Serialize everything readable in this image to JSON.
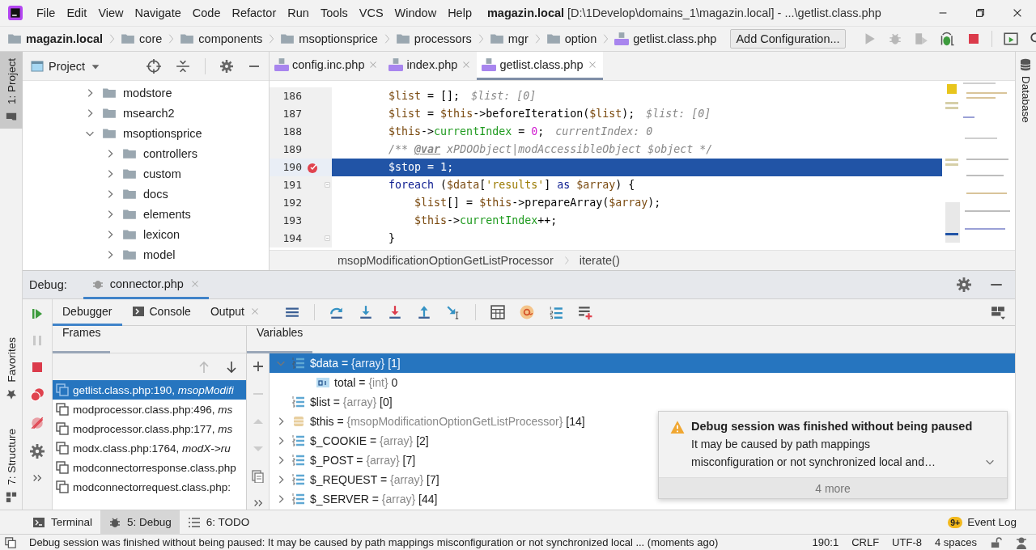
{
  "window": {
    "project": "magazin.local",
    "title": "[D:\\1Develop\\domains_1\\magazin.local] - ...\\getlist.class.php"
  },
  "menu": [
    "File",
    "Edit",
    "View",
    "Navigate",
    "Code",
    "Refactor",
    "Run",
    "Tools",
    "VCS",
    "Window",
    "Help"
  ],
  "navbar": {
    "crumbs": [
      {
        "label": "magazin.local",
        "kind": "root"
      },
      {
        "label": "core",
        "kind": "folder"
      },
      {
        "label": "components",
        "kind": "folder"
      },
      {
        "label": "msoptionsprice",
        "kind": "folder"
      },
      {
        "label": "processors",
        "kind": "folder"
      },
      {
        "label": "mgr",
        "kind": "folder"
      },
      {
        "label": "option",
        "kind": "folder"
      },
      {
        "label": "getlist.class.php",
        "kind": "php"
      }
    ],
    "config_button": "Add Configuration..."
  },
  "left_strip": [
    {
      "label": "1: Project",
      "kind": "project",
      "selected": true
    },
    {
      "label": "Favorites",
      "kind": "favorites",
      "selected": false
    },
    {
      "label": "7: Structure",
      "kind": "structure",
      "selected": false
    }
  ],
  "right_strip": [
    {
      "label": "Database"
    }
  ],
  "project_panel": {
    "title": "Project",
    "tree": [
      {
        "label": "modstore",
        "expanded": false
      },
      {
        "label": "msearch2",
        "expanded": false
      },
      {
        "label": "msoptionsprice",
        "expanded": true,
        "children": [
          {
            "label": "controllers",
            "expanded": false
          },
          {
            "label": "custom",
            "expanded": false
          },
          {
            "label": "docs",
            "expanded": false
          },
          {
            "label": "elements",
            "expanded": false
          },
          {
            "label": "lexicon",
            "expanded": false
          },
          {
            "label": "model",
            "expanded": false
          }
        ]
      }
    ]
  },
  "editor": {
    "tabs": [
      {
        "label": "config.inc.php",
        "selected": false
      },
      {
        "label": "index.php",
        "selected": false
      },
      {
        "label": "getlist.class.php",
        "selected": true
      }
    ],
    "lines": [
      {
        "number": "186",
        "selected": false,
        "breakpoint": false,
        "fold": false,
        "tokens": [
          {
            "text": "        $list",
            "kind": "var"
          },
          {
            "text": " = [];",
            "kind": "plain"
          },
          {
            "text": "$list: [0]",
            "kind": "hint"
          }
        ]
      },
      {
        "number": "187",
        "selected": false,
        "breakpoint": false,
        "fold": false,
        "tokens": [
          {
            "text": "        $list",
            "kind": "var"
          },
          {
            "text": " = ",
            "kind": "plain"
          },
          {
            "text": "$this",
            "kind": "var"
          },
          {
            "text": "->beforeIteration(",
            "kind": "plain"
          },
          {
            "text": "$list",
            "kind": "var"
          },
          {
            "text": ");",
            "kind": "plain"
          },
          {
            "text": "$list: [0]",
            "kind": "hint"
          }
        ]
      },
      {
        "number": "188",
        "selected": false,
        "breakpoint": false,
        "fold": false,
        "tokens": [
          {
            "text": "        $this",
            "kind": "var"
          },
          {
            "text": "->",
            "kind": "plain"
          },
          {
            "text": "currentIndex",
            "kind": "field"
          },
          {
            "text": " = ",
            "kind": "plain"
          },
          {
            "text": "0",
            "kind": "number"
          },
          {
            "text": ";",
            "kind": "plain"
          },
          {
            "text": "currentIndex: 0",
            "kind": "hint"
          }
        ]
      },
      {
        "number": "189",
        "selected": false,
        "breakpoint": false,
        "fold": false,
        "tokens": [
          {
            "text": "        /** ",
            "kind": "comment"
          },
          {
            "text": "@var",
            "kind": "doctag"
          },
          {
            "text": " xPDOObject|modAccessibleObject $object */",
            "kind": "comment"
          }
        ]
      },
      {
        "number": "190",
        "selected": true,
        "breakpoint": true,
        "fold": false,
        "tokens": [
          {
            "text": "        $stop",
            "kind": "var"
          },
          {
            "text": " = ",
            "kind": "plain"
          },
          {
            "text": "1",
            "kind": "number"
          },
          {
            "text": ";",
            "kind": "plain"
          }
        ]
      },
      {
        "number": "191",
        "selected": false,
        "breakpoint": false,
        "fold": true,
        "tokens": [
          {
            "text": "        foreach",
            "kind": "keyword"
          },
          {
            "text": " (",
            "kind": "plain"
          },
          {
            "text": "$data",
            "kind": "var"
          },
          {
            "text": "[",
            "kind": "plain"
          },
          {
            "text": "'results'",
            "kind": "string"
          },
          {
            "text": "] ",
            "kind": "plain"
          },
          {
            "text": "as",
            "kind": "keyword"
          },
          {
            "text": " $array",
            "kind": "var"
          },
          {
            "text": ") {",
            "kind": "plain"
          }
        ]
      },
      {
        "number": "192",
        "selected": false,
        "breakpoint": false,
        "fold": false,
        "tokens": [
          {
            "text": "            $list",
            "kind": "var"
          },
          {
            "text": "[] = ",
            "kind": "plain"
          },
          {
            "text": "$this",
            "kind": "var"
          },
          {
            "text": "->prepareArray(",
            "kind": "plain"
          },
          {
            "text": "$array",
            "kind": "var"
          },
          {
            "text": ");",
            "kind": "plain"
          }
        ]
      },
      {
        "number": "193",
        "selected": false,
        "breakpoint": false,
        "fold": false,
        "tokens": [
          {
            "text": "            $this",
            "kind": "var"
          },
          {
            "text": "->",
            "kind": "plain"
          },
          {
            "text": "currentIndex",
            "kind": "field"
          },
          {
            "text": "++;",
            "kind": "plain"
          }
        ]
      },
      {
        "number": "194",
        "selected": false,
        "breakpoint": false,
        "fold": true,
        "tokens": [
          {
            "text": "        }",
            "kind": "plain"
          }
        ]
      }
    ],
    "breadcrumb": [
      "msopModificationOptionGetListProcessor",
      "iterate()"
    ]
  },
  "debug": {
    "label": "Debug:",
    "session_tab": {
      "label": "connector.php",
      "selected": true
    },
    "tabs": [
      {
        "label": "Debugger",
        "kind": "plain",
        "selected": true
      },
      {
        "label": "Console",
        "kind": "console",
        "selected": false
      },
      {
        "label": "Output",
        "kind": "closable",
        "selected": false
      }
    ],
    "frames_title": "Frames",
    "variables_title": "Variables",
    "frames": [
      {
        "text": "getlist.class.php:190, *msopModifi*",
        "selected": true
      },
      {
        "text": "modprocessor.class.php:496, *ms*",
        "selected": false
      },
      {
        "text": "modprocessor.class.php:177, *ms*",
        "selected": false
      },
      {
        "text": "modx.class.php:1764, *modX->ru*",
        "selected": false
      },
      {
        "text": "modconnectorresponse.class.php",
        "selected": false
      },
      {
        "text": "modconnectorrequest.class.php:",
        "selected": false
      }
    ],
    "variables": [
      {
        "name": "$data =",
        "type": "{array}",
        "value": "[1]",
        "kind": "array",
        "expanded": true,
        "selected": true,
        "children": [
          {
            "name": "total =",
            "type": "{int}",
            "value": "0",
            "kind": "int",
            "selected": false
          }
        ]
      },
      {
        "name": "$list =",
        "type": "{array}",
        "value": "[0]",
        "kind": "array",
        "selected": false
      },
      {
        "name": "$this =",
        "type": "{msopModificationOptionGetListProcessor}",
        "value": "[14]",
        "kind": "object",
        "expanded": false,
        "selected": false
      },
      {
        "name": "$_COOKIE =",
        "type": "{array}",
        "value": "[2]",
        "kind": "array",
        "expanded": false,
        "selected": false
      },
      {
        "name": "$_POST =",
        "type": "{array}",
        "value": "[7]",
        "kind": "array",
        "expanded": false,
        "selected": false
      },
      {
        "name": "$_REQUEST =",
        "type": "{array}",
        "value": "[7]",
        "kind": "array",
        "expanded": false,
        "selected": false
      },
      {
        "name": "$_SERVER =",
        "type": "{array}",
        "value": "[44]",
        "kind": "array",
        "expanded": false,
        "selected": false
      }
    ]
  },
  "notification": {
    "title": "Debug session was finished without being paused",
    "body": "It may be caused by path mappings misconfiguration or not synchronized local and…",
    "more": "4 more"
  },
  "tool_bar": {
    "items": [
      {
        "label": "Terminal",
        "kind": "terminal",
        "selected": false
      },
      {
        "label": "5: Debug",
        "kind": "debug",
        "selected": true
      },
      {
        "label": "6: TODO",
        "kind": "todo",
        "selected": false
      }
    ],
    "event_log": {
      "label": "Event Log",
      "badge": "9+"
    }
  },
  "status_bar": {
    "message": "Debug session was finished without being paused: It may be caused by path mappings misconfiguration or not synchronized local ... (moments ago)",
    "position": "190:1",
    "line_separator": "CRLF",
    "encoding": "UTF-8",
    "indent": "4 spaces"
  }
}
